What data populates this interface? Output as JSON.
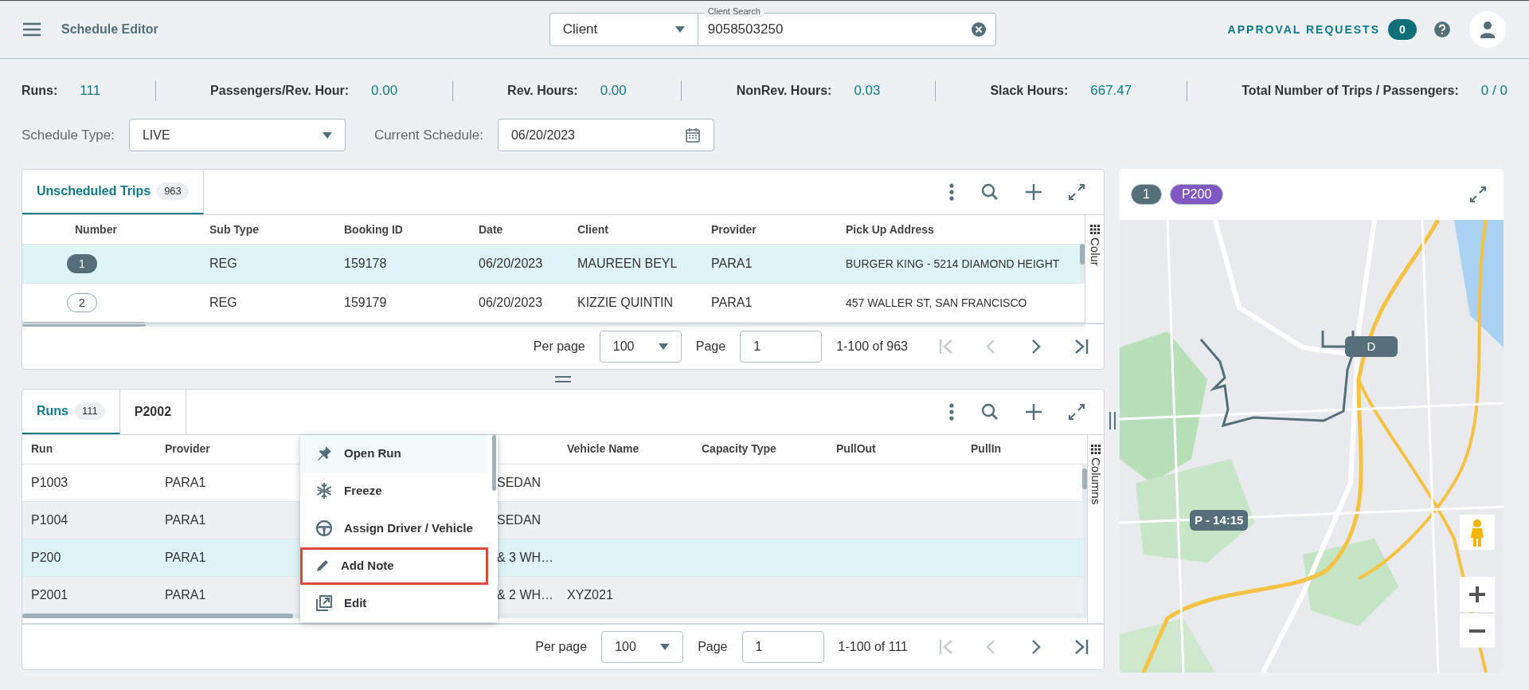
{
  "app_bar": {
    "title": "Schedule Editor",
    "search_type": "Client",
    "search_label": "Client Search",
    "search_value": "9058503250",
    "approval_label": "APPROVAL REQUESTS",
    "approval_count": "0"
  },
  "stats": [
    {
      "label": "Runs:",
      "value": "111"
    },
    {
      "label": "Passengers/Rev. Hour:",
      "value": "0.00"
    },
    {
      "label": "Rev. Hours:",
      "value": "0.00"
    },
    {
      "label": "NonRev. Hours:",
      "value": "0.03"
    },
    {
      "label": "Slack Hours:",
      "value": "667.47"
    },
    {
      "label": "Total Number of Trips / Passengers:",
      "value": "0 / 0"
    }
  ],
  "filters": {
    "schedule_type_label": "Schedule Type:",
    "schedule_type": "LIVE",
    "current_schedule_label": "Current Schedule:",
    "current_schedule": "06/20/2023"
  },
  "trips_panel": {
    "tabs": [
      {
        "label": "Unscheduled Trips",
        "count": "963",
        "selected": true
      }
    ],
    "columns": [
      "Number",
      "Sub Type",
      "Booking ID",
      "Date",
      "Client",
      "Provider",
      "Pick Up Address"
    ],
    "rows": [
      {
        "cells": [
          "1",
          "REG",
          "159178",
          "06/20/2023",
          "MAUREEN BEYL",
          "PARA1",
          "BURGER KING - 5214 DIAMOND HEIGHT"
        ],
        "selected": true
      },
      {
        "cells": [
          "2",
          "REG",
          "159179",
          "06/20/2023",
          "KIZZIE QUINTIN",
          "PARA1",
          "457 WALLER ST, SAN FRANCISCO"
        ],
        "selected": false
      }
    ],
    "columns_toggle": "Colur",
    "pagination": {
      "per_page_label": "Per page",
      "per_page": "100",
      "page_label": "Page",
      "page": "1",
      "range": "1-100 of 963"
    }
  },
  "runs_panel": {
    "tabs": [
      {
        "label": "Runs",
        "count": "111",
        "selected": true
      },
      {
        "label": "P2002",
        "selected": false
      }
    ],
    "columns": [
      "Run",
      "Provider",
      "Vehicle Name",
      "Capacity Type",
      "PullOut",
      "PullIn"
    ],
    "rows": [
      {
        "run": "P1003",
        "provider": "PARA1",
        "column_4": "SEDAN",
        "selected": false
      },
      {
        "run": "P1004",
        "provider": "PARA1",
        "column_4": "SEDAN",
        "selected": false
      },
      {
        "run": "P200",
        "provider": "PARA1",
        "column_4": "& 3 WH…",
        "selected": true
      },
      {
        "run": "P2001",
        "provider": "PARA1",
        "column_4": "& 2 WH…",
        "vehicle_name": "XYZ021",
        "selected": false
      }
    ],
    "columns_toggle": "Columns",
    "pagination": {
      "per_page_label": "Per page",
      "per_page": "100",
      "page_label": "Page",
      "page": "1",
      "range": "1-100 of 111"
    }
  },
  "context_menu": {
    "items": [
      {
        "label": "Open Run",
        "kind": "pin",
        "hovered": true,
        "highlighted": false
      },
      {
        "label": "Freeze",
        "kind": "snowflake",
        "hovered": false,
        "highlighted": false
      },
      {
        "label": "Assign Driver / Vehicle",
        "kind": "wheel",
        "hovered": false,
        "highlighted": false
      },
      {
        "label": "Add Note",
        "kind": "pencil",
        "hovered": false,
        "highlighted": true
      },
      {
        "label": "Edit",
        "kind": "edit",
        "hovered": false,
        "highlighted": false
      }
    ]
  },
  "map": {
    "chips": [
      {
        "label": "1",
        "color": "#546e7a"
      },
      {
        "label": "P200",
        "color": "#7e57c2"
      }
    ],
    "markers": [
      {
        "label": "D"
      },
      {
        "label": "P - 14:15"
      }
    ]
  }
}
